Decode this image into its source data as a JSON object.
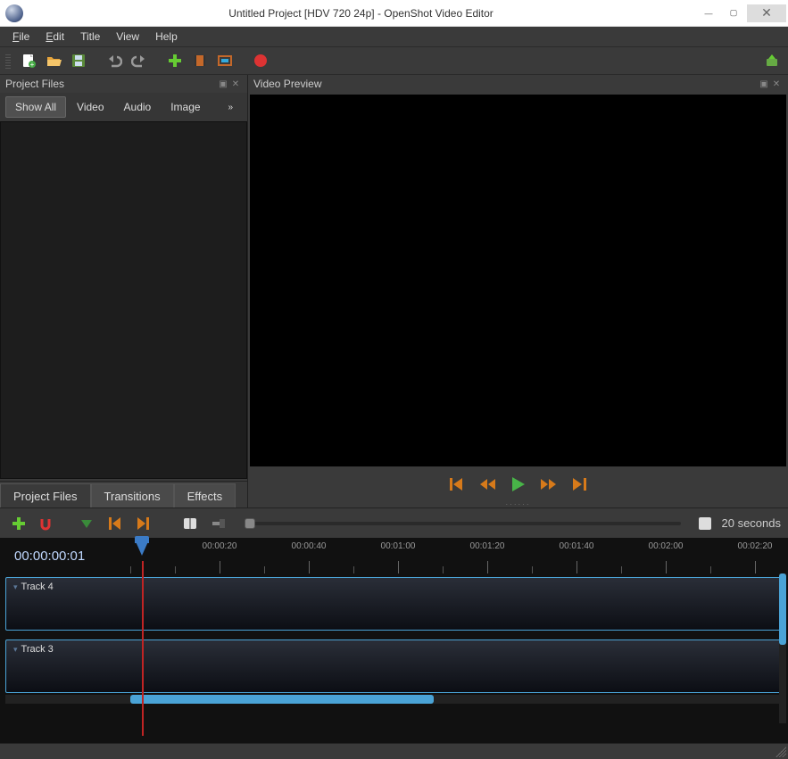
{
  "window": {
    "title": "Untitled Project [HDV 720 24p] - OpenShot Video Editor"
  },
  "menu": {
    "file": "File",
    "edit": "Edit",
    "title": "Title",
    "view": "View",
    "help": "Help"
  },
  "panels": {
    "project_files_title": "Project Files",
    "preview_title": "Video Preview"
  },
  "filter": {
    "showall": "Show All",
    "video": "Video",
    "audio": "Audio",
    "image": "Image",
    "more": "»"
  },
  "tabs": {
    "project_files": "Project Files",
    "transitions": "Transitions",
    "effects": "Effects"
  },
  "zoom": {
    "label": "20 seconds"
  },
  "timeline": {
    "current": "00:00:00:01",
    "marks": [
      "00:00:20",
      "00:00:40",
      "00:01:00",
      "00:01:20",
      "00:01:40",
      "00:02:00",
      "00:02:20"
    ],
    "tracks": [
      {
        "name": "Track 4"
      },
      {
        "name": "Track 3"
      }
    ]
  }
}
